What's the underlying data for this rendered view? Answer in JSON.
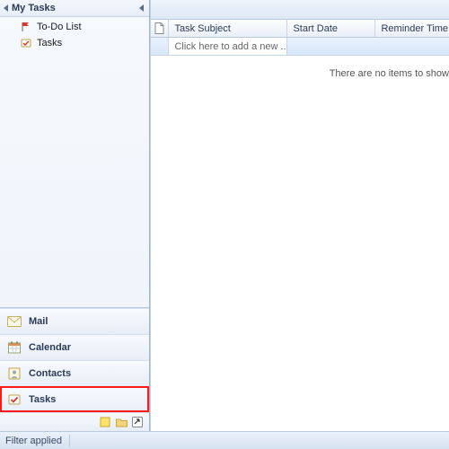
{
  "sidebar": {
    "header": "My Tasks",
    "items": [
      {
        "label": "To-Do List",
        "icon": "flag"
      },
      {
        "label": "Tasks",
        "icon": "task"
      }
    ]
  },
  "modules": [
    {
      "label": "Mail",
      "icon": "mail"
    },
    {
      "label": "Calendar",
      "icon": "calendar"
    },
    {
      "label": "Contacts",
      "icon": "contacts"
    },
    {
      "label": "Tasks",
      "icon": "task",
      "highlight": true
    }
  ],
  "small_modules": [
    {
      "icon": "notes"
    },
    {
      "icon": "folder"
    },
    {
      "icon": "shortcut"
    }
  ],
  "grid": {
    "columns": {
      "subject": "Task Subject",
      "start": "Start Date",
      "reminder": "Reminder Time"
    },
    "add_placeholder": "Click here to add a new ...",
    "empty_text": "There are no items to show"
  },
  "status": {
    "filter": "Filter applied"
  }
}
